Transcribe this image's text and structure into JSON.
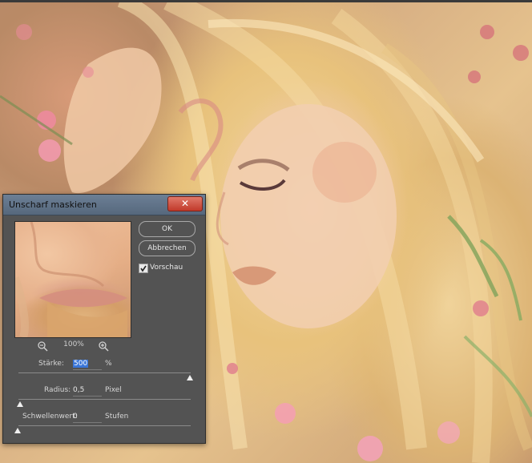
{
  "dialog": {
    "title": "Unscharf maskieren",
    "close_glyph": "✕",
    "ok_label": "OK",
    "cancel_label": "Abbrechen",
    "preview_checkbox_label": "Vorschau",
    "preview_checked": true,
    "zoom_level": "100%",
    "amount": {
      "label": "Stärke:",
      "value": "500",
      "unit": "%",
      "slider_fraction": 1.0
    },
    "radius": {
      "label": "Radius:",
      "value": "0,5",
      "unit": "Pixel",
      "slider_fraction": 0.0
    },
    "threshold": {
      "label": "Schwellenwert:",
      "value": "0",
      "unit": "Stufen",
      "slider_fraction": 0.0
    }
  },
  "icons": {
    "close": "close-icon",
    "zoom_out": "zoom-out-icon",
    "zoom_in": "zoom-in-icon",
    "check": "checkmark-icon"
  },
  "colors": {
    "dialog_bg": "#535353",
    "titlebar": "#5d7087",
    "close_button": "#c94a3a",
    "selection": "#3a76d8"
  }
}
